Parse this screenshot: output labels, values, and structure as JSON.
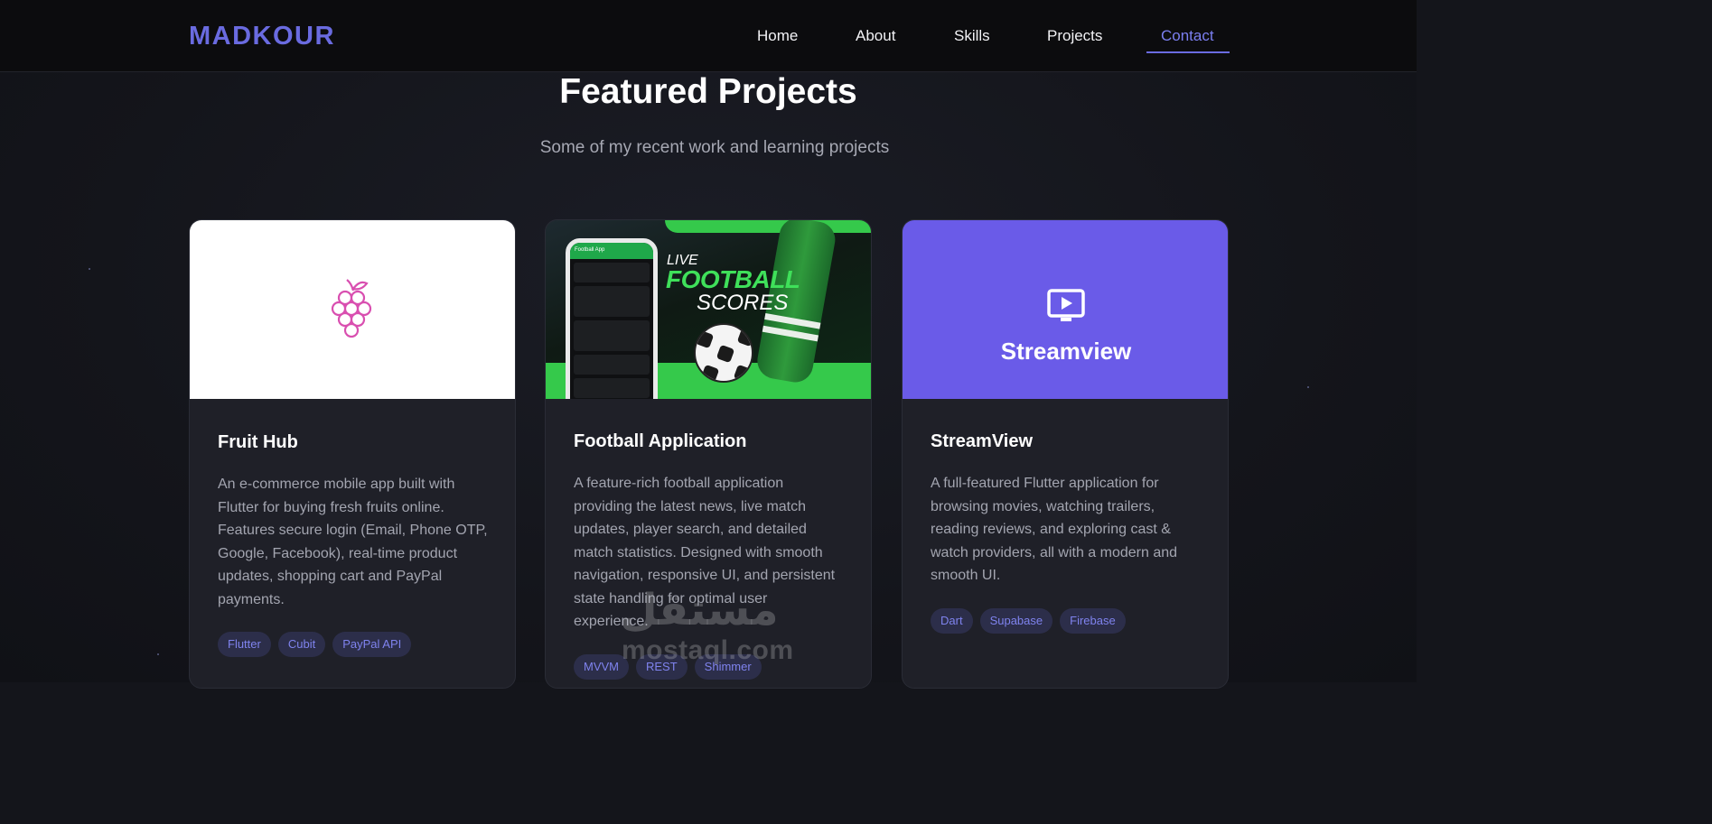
{
  "header": {
    "logo": "MADKOUR",
    "nav": [
      {
        "label": "Home",
        "active": false
      },
      {
        "label": "About",
        "active": false
      },
      {
        "label": "Skills",
        "active": false
      },
      {
        "label": "Projects",
        "active": false
      },
      {
        "label": "Contact",
        "active": true
      }
    ]
  },
  "section": {
    "title": "Featured Projects",
    "subtitle": "Some of my recent work and learning projects"
  },
  "projects": [
    {
      "title": "Fruit Hub",
      "media_icon": "grape-icon",
      "description": "An e-commerce mobile app built with Flutter for buying fresh fruits online. Features secure login (Email, Phone OTP, Google, Facebook), real-time product updates, shopping cart and PayPal payments.",
      "tags": [
        "Flutter",
        "Cubit",
        "PayPal API"
      ]
    },
    {
      "title": "Football Application",
      "banner": {
        "line1": "LIVE",
        "line2": "FOOTBALL",
        "line3": "SCORES",
        "phone_title": "Football App"
      },
      "description": "A feature-rich football application providing the latest news, live match updates, player search, and detailed match statistics. Designed with smooth navigation, responsive UI, and persistent state handling for optimal user experience.",
      "tags": [
        "MVVM",
        "REST",
        "Shimmer"
      ]
    },
    {
      "title": "StreamView",
      "media": {
        "icon": "play-screen-icon",
        "label": "Streamview"
      },
      "description": "A full-featured Flutter application for browsing movies, watching trailers, reading reviews, and exploring cast & watch providers, all with a modern and smooth UI.",
      "tags": [
        "Dart",
        "Supabase",
        "Firebase"
      ]
    }
  ],
  "watermark": {
    "arabic": "مستقل",
    "latin": "mostaql.com"
  },
  "colors": {
    "accent": "#6a6be0",
    "card": "#1f2028",
    "streamview": "#6a5be8",
    "fruit_icon": "#d94fb0",
    "football_green": "#35c94b"
  }
}
